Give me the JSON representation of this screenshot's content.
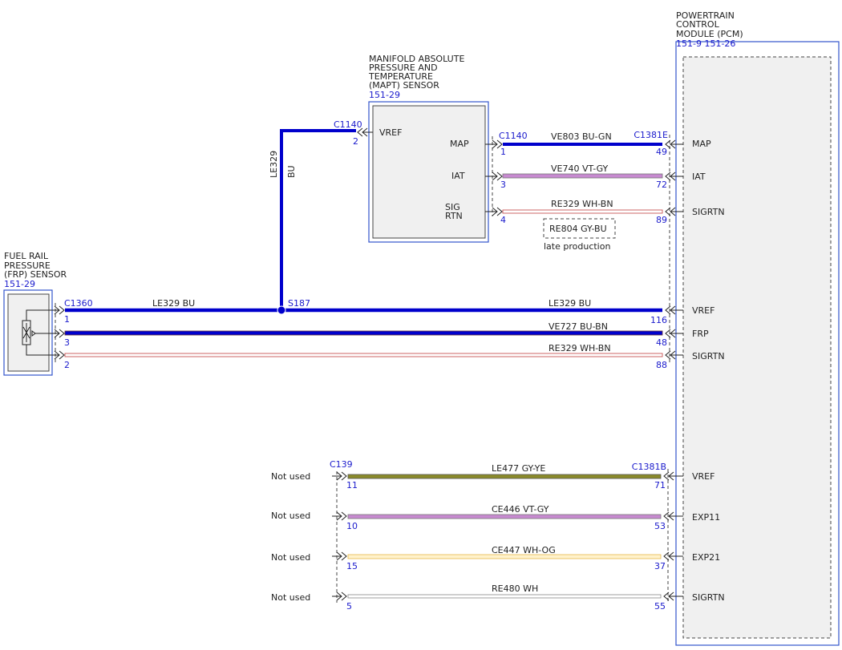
{
  "colors": {
    "connector_blue": "#1a1acc",
    "wire_blue": "#0000cc",
    "wire_violet": "#c78ad0",
    "wire_olive": "#8a8a2a",
    "wire_yellow": "#e6d28a",
    "wire_white": "#bbbbbb",
    "wire_brown": "#c04040"
  },
  "pcm": {
    "title_lines": [
      "POWERTRAIN",
      "CONTROL",
      "MODULE (PCM)"
    ],
    "refs": "151-9  151-26",
    "pins": [
      {
        "label": "MAP",
        "pin": "49"
      },
      {
        "label": "IAT",
        "pin": "72"
      },
      {
        "label": "SIGRTN",
        "pin": "89"
      },
      {
        "label": "VREF",
        "pin": "116"
      },
      {
        "label": "FRP",
        "pin": "48"
      },
      {
        "label": "SIGRTN",
        "pin": "88"
      },
      {
        "label": "VREF",
        "pin": "71"
      },
      {
        "label": "EXP11",
        "pin": "53"
      },
      {
        "label": "EXP21",
        "pin": "37"
      },
      {
        "label": "SIGRTN",
        "pin": "55"
      }
    ],
    "connector_top": "C1381E",
    "connector_bottom": "C1381B"
  },
  "mapt": {
    "title_lines": [
      "MANIFOLD ABSOLUTE",
      "PRESSURE AND",
      "TEMPERATURE",
      "(MAPT) SENSOR"
    ],
    "ref": "151-29",
    "vref": "VREF",
    "map": "MAP",
    "iat": "IAT",
    "sig1": "SIG",
    "sig2": "RTN",
    "conn_vref": "C1140",
    "pin_vref": "2",
    "conn_right": "C1140",
    "pin_map": "1",
    "pin_iat": "3",
    "pin_sig": "4"
  },
  "frp": {
    "title_lines": [
      "FUEL RAIL",
      "PRESSURE",
      "(FRP) SENSOR"
    ],
    "ref": "151-29",
    "conn": "C1360",
    "pin_vref": "1",
    "pin_frp": "3",
    "pin_sig": "2"
  },
  "wires": {
    "ve803": "VE803   BU-GN",
    "ve740": "VE740   VT-GY",
    "re329_top": "RE329   WH-BN",
    "re804": "RE804   GY-BU",
    "late": "late production",
    "le329_vert_a": "LE329",
    "le329_vert_b": "BU",
    "le329_left": "LE329   BU",
    "le329_right": "LE329   BU",
    "splice": "S187",
    "ve727": "VE727   BU-BN",
    "re329_bot": "RE329   WH-BN",
    "le477": "LE477   GY-YE",
    "ce446": "CE446   VT-GY",
    "ce447": "CE447   WH-OG",
    "re480": "RE480   WH"
  },
  "c139": {
    "conn": "C139",
    "pins": [
      "11",
      "10",
      "15",
      "5"
    ],
    "not_used": "Not used"
  }
}
